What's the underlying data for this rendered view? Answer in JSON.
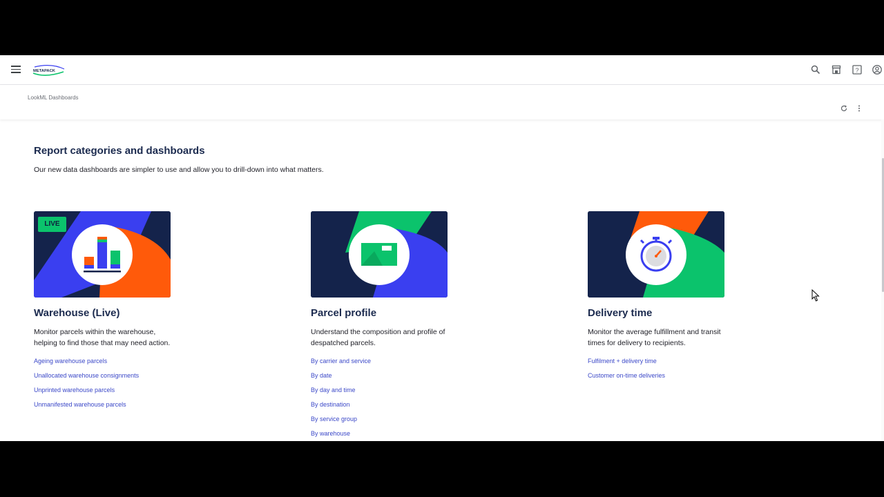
{
  "header": {
    "logo_text": "METAPACK",
    "icons": [
      "search-icon",
      "marketplace-icon",
      "help-icon",
      "account-icon"
    ]
  },
  "subheader": {
    "breadcrumb": "LookML Dashboards",
    "icons": [
      "refresh-icon",
      "more-vert-icon"
    ]
  },
  "main": {
    "title": "Report categories and dashboards",
    "subtitle": "Our new data dashboards are simpler to use and allow you to drill-down into what matters."
  },
  "cards": [
    {
      "badge": "LIVE",
      "title": "Warehouse (Live)",
      "description": "Monitor parcels within the warehouse, helping to find those that may need action.",
      "links": [
        "Ageing warehouse parcels",
        "Unallocated warehouse consignments",
        "Unprinted warehouse parcels",
        "Unmanifested warehouse parcels"
      ]
    },
    {
      "title": "Parcel profile",
      "description": "Understand the composition and profile of despatched parcels.",
      "links": [
        "By carrier and service",
        "By date",
        "By day and time",
        "By destination",
        "By service group",
        "By warehouse"
      ]
    },
    {
      "title": "Delivery time",
      "description": "Monitor the average fulfillment and transit times for delivery to recipients.",
      "links": [
        "Fulfilment + delivery time",
        "Customer on-time deliveries"
      ]
    }
  ],
  "colors": {
    "navy": "#14234b",
    "orange": "#ff5a0a",
    "blue": "#3a3ff0",
    "green": "#0bc36c",
    "link": "#3b48c8",
    "title": "#1c2b4f"
  }
}
